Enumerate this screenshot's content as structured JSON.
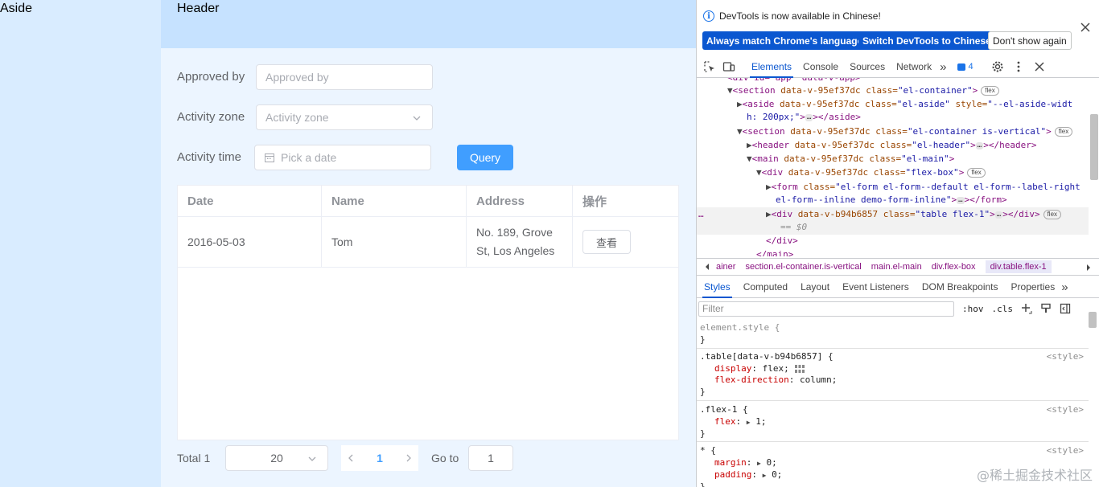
{
  "app": {
    "aside": "Aside",
    "header": "Header",
    "form": {
      "approved_label": "Approved by",
      "approved_placeholder": "Approved by",
      "zone_label": "Activity zone",
      "zone_placeholder": "Activity zone",
      "time_label": "Activity time",
      "time_placeholder": "Pick a date",
      "query_label": "Query"
    },
    "table": {
      "headers": [
        "Date",
        "Name",
        "Address",
        "操作"
      ],
      "rows": [
        {
          "date": "2016-05-03",
          "name": "Tom",
          "address": "No. 189, Grove St, Los Angeles",
          "action": "查看"
        }
      ]
    },
    "pager": {
      "total": "Total 1",
      "page_size": "20",
      "current": "1",
      "goto_label": "Go to",
      "jump_value": "1"
    }
  },
  "devtools": {
    "infobar": {
      "message": "DevTools is now available in Chinese!",
      "btn_match": "Always match Chrome's language",
      "btn_switch": "Switch DevTools to Chinese",
      "btn_dismiss": "Don't show again"
    },
    "tabs": [
      "Elements",
      "Console",
      "Sources",
      "Network"
    ],
    "more_tabs": "»",
    "issues_count": "4",
    "elements": {
      "l0": "<div id=\"app\" data-v-app>",
      "l1_tag": "<section",
      "l1_attrs": " data-v-95ef37dc class=",
      "l1_val": "\"el-container\"",
      "l1_end": ">",
      "l2_tag": "<aside",
      "l2_attrs": " data-v-95ef37dc class=",
      "l2_val": "\"el-aside\"",
      "l2_style": " style=",
      "l2_sval": "\"--el-aside-widt",
      "l2b": "h: 200px;\"",
      "l2b_end": "></aside>",
      "l3_tag": "<section",
      "l3_attrs": " data-v-95ef37dc class=",
      "l3_val": "\"el-container is-vertical\"",
      "l3_end": ">",
      "l4_tag": "<header",
      "l4_attrs": " data-v-95ef37dc class=",
      "l4_val": "\"el-header\"",
      "l4_end": "></header>",
      "l5_tag": "<main",
      "l5_attrs": " data-v-95ef37dc class=",
      "l5_val": "\"el-main\"",
      "l5_end": ">",
      "l6_tag": "<div",
      "l6_attrs": " data-v-95ef37dc class=",
      "l6_val": "\"flex-box\"",
      "l6_end": ">",
      "l7_tag": "<form",
      "l7_attrs": " class=",
      "l7_val": "\"el-form el-form--default el-form--label-right",
      "l7b": "el-form--inline demo-form-inline\"",
      "l7b_end": "></form>",
      "l8_tag": "<div",
      "l8_attrs": " data-v-b94b6857 class=",
      "l8_val": "\"table flex-1\"",
      "l8_end": "></div>",
      "l8_eq": "== $0",
      "l9": "</div>",
      "l10": "</main>",
      "pill_flex": "flex",
      "dots": "…",
      "row_dots": "…"
    },
    "breadcrumbs": [
      "ainer",
      "section.el-container.is-vertical",
      "main.el-main",
      "div.flex-box",
      "div.table.flex-1"
    ],
    "subtabs": [
      "Styles",
      "Computed",
      "Layout",
      "Event Listeners",
      "DOM Breakpoints",
      "Properties"
    ],
    "subtabs_more": "»",
    "filter_placeholder": "Filter",
    "hov": ":hov",
    "cls": ".cls",
    "styles": {
      "r0_sel": "element.style {",
      "r0_close": "}",
      "r1_sel": ".table[data-v-b94b6857] {",
      "r1_src": "<style>",
      "r1_p1": "display",
      "r1_v1": ": flex;",
      "r1_p2": "flex-direction",
      "r1_v2": ": column;",
      "r1_close": "}",
      "r2_sel": ".flex-1 {",
      "r2_src": "<style>",
      "r2_p1": "flex",
      "r2_v1": ": ",
      "r2_v1b": "1;",
      "r2_close": "}",
      "r3_sel": "* {",
      "r3_src": "<style>",
      "r3_p1": "margin",
      "r3_v1": ": ",
      "r3_v1b": "0;",
      "r3_p2": "padding",
      "r3_v2": ": ",
      "r3_v2b": "0;",
      "r3_close": "}"
    },
    "watermark": "@稀土掘金技术社区"
  }
}
